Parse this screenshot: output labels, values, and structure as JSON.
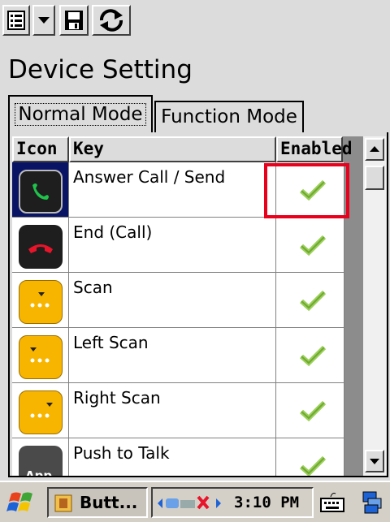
{
  "window": {
    "title": "Device Setting"
  },
  "toolbar": {
    "icons": [
      "list-menu-icon",
      "dropdown-arrow-icon",
      "save-icon",
      "refresh-icon"
    ]
  },
  "tabs": [
    {
      "label": "Normal Mode",
      "active": true
    },
    {
      "label": "Function Mode",
      "active": false
    }
  ],
  "table": {
    "columns": [
      "Icon",
      "Key",
      "Enabled"
    ],
    "rows": [
      {
        "key": "Answer Call / Send",
        "icon": "answer-call-icon",
        "enabled": true,
        "selected": true
      },
      {
        "key": "End (Call)",
        "icon": "end-call-icon",
        "enabled": true
      },
      {
        "key": "Scan",
        "icon": "scan-icon",
        "enabled": true
      },
      {
        "key": "Left Scan",
        "icon": "left-scan-icon",
        "enabled": true
      },
      {
        "key": "Right Scan",
        "icon": "right-scan-icon",
        "enabled": true
      },
      {
        "key": "Push to Talk",
        "icon": "app-icon",
        "icon_text": "App",
        "enabled": true
      }
    ]
  },
  "taskbar": {
    "task_label": "Butt...",
    "clock": "3:10 PM"
  },
  "colors": {
    "highlight": "#e8001c",
    "selection": "#0a1464",
    "check": "#8dc63f"
  }
}
